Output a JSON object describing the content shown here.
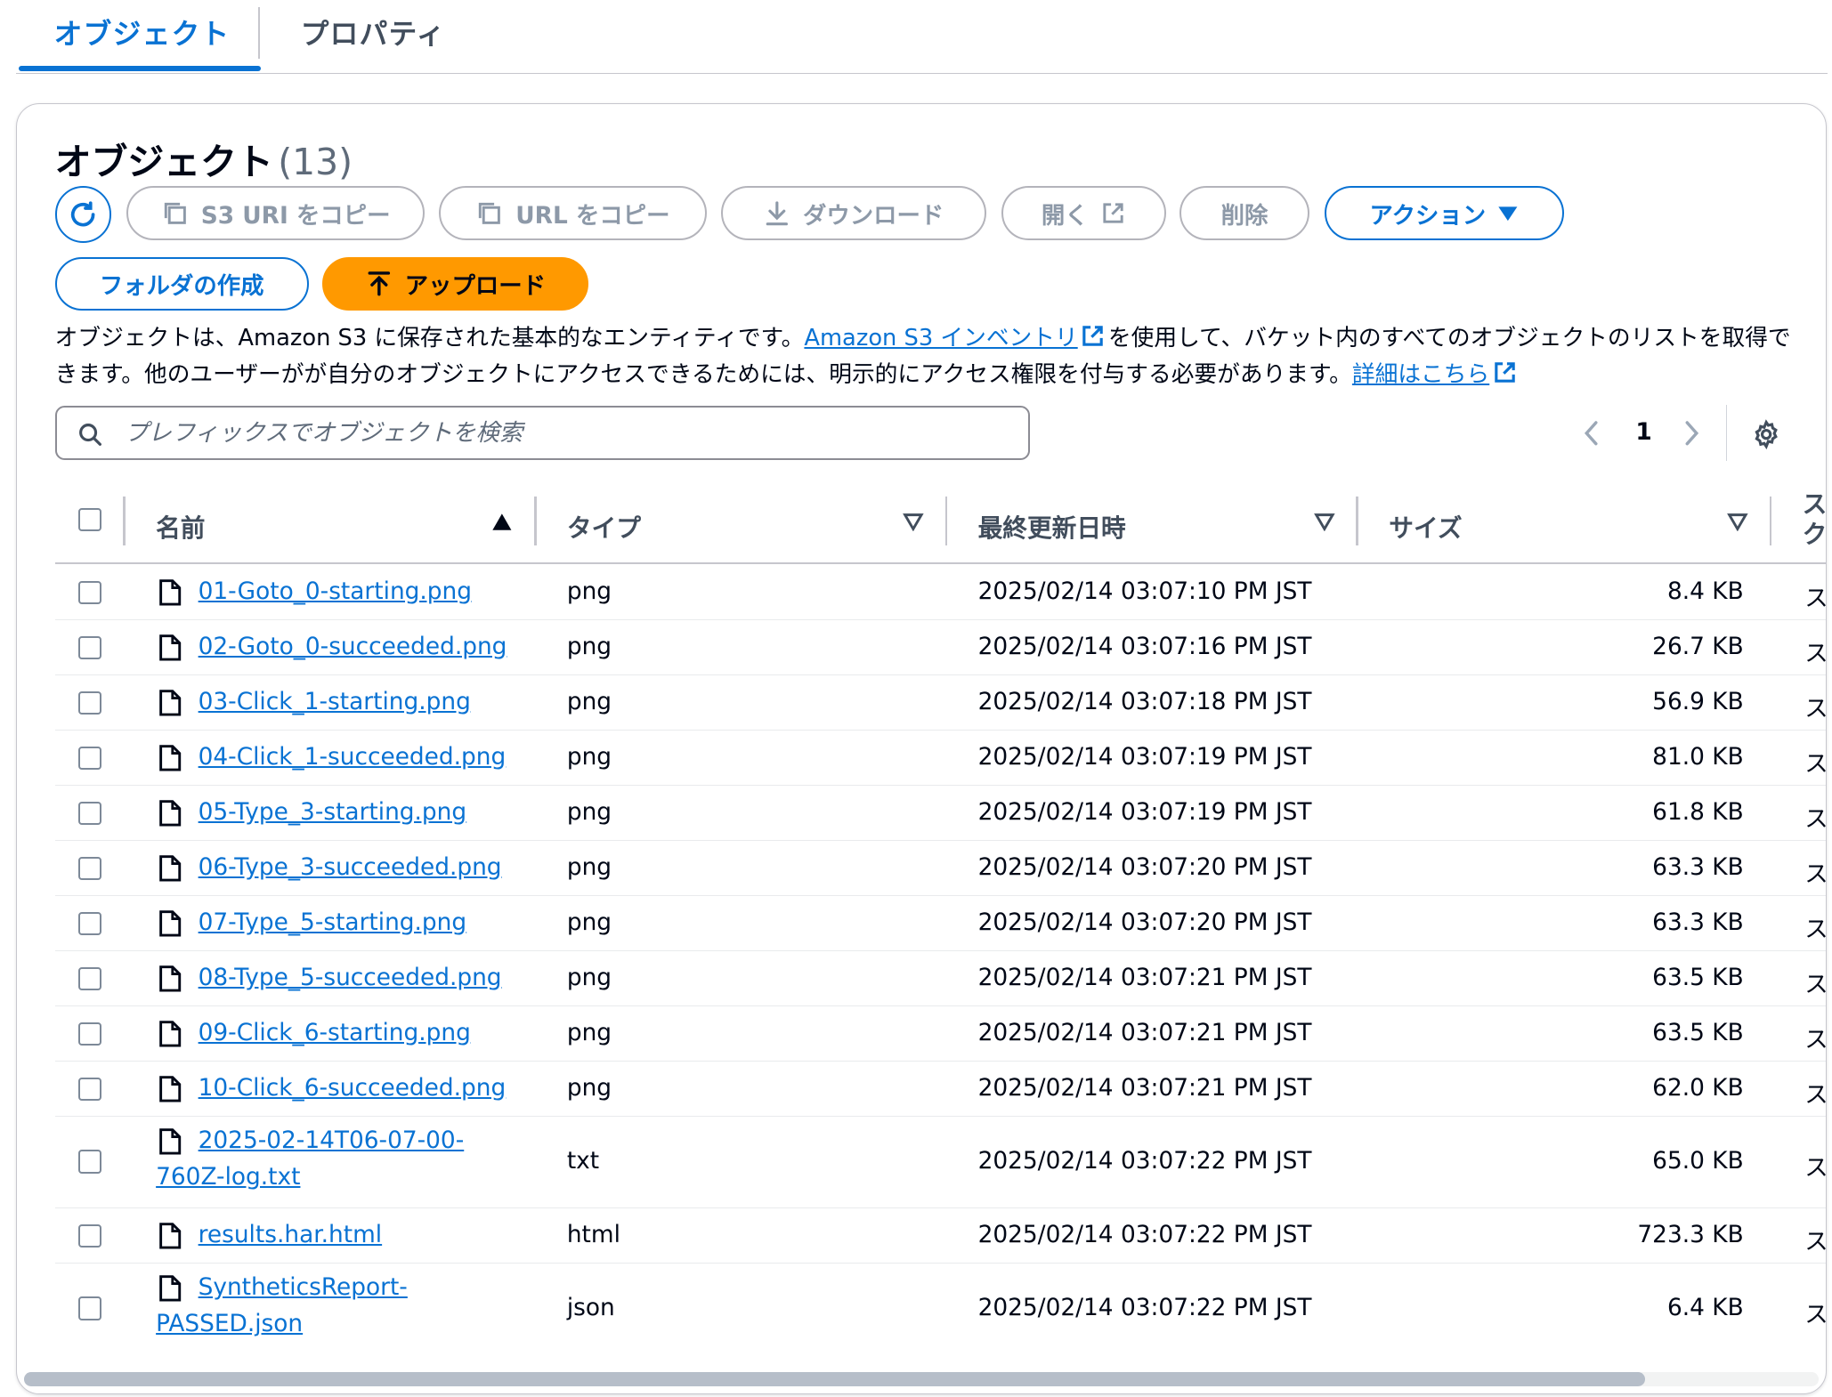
{
  "tabs": [
    {
      "label": "オブジェクト",
      "active": true
    },
    {
      "label": "プロパティ",
      "active": false
    }
  ],
  "header": {
    "title": "オブジェクト",
    "count": "(13)"
  },
  "toolbar": {
    "copy_s3_uri": "S3 URI をコピー",
    "copy_url": "URL をコピー",
    "download": "ダウンロード",
    "open": "開く",
    "delete": "削除",
    "actions": "アクション",
    "create_folder": "フォルダの作成",
    "upload": "アップロード"
  },
  "description": {
    "part1": "オブジェクトは、Amazon S3 に保存された基本的なエンティティです。",
    "link1": "Amazon S3 インベントリ",
    "part2": "を使用して、バケット内のすべてのオブジェクトのリストを取得できます。他のユーザーがが自分のオブジェクトにアクセスできるためには、明示的にアクセス権限を付与する必要があります。",
    "link2": "詳細はこちら"
  },
  "search": {
    "placeholder": "プレフィックスでオブジェクトを検索"
  },
  "pagination": {
    "prev": "‹",
    "page": "1",
    "next": "›"
  },
  "table": {
    "columns": {
      "name": "名前",
      "type": "タイプ",
      "modified": "最終更新日時",
      "size": "サイズ",
      "storage": "ス ク"
    },
    "rows": [
      {
        "name": "01-Goto_0-starting.png",
        "type": "png",
        "modified": "2025/02/14 03:07:10 PM JST",
        "size": "8.4 KB",
        "storage": "ス"
      },
      {
        "name": "02-Goto_0-succeeded.png",
        "type": "png",
        "modified": "2025/02/14 03:07:16 PM JST",
        "size": "26.7 KB",
        "storage": "ス"
      },
      {
        "name": "03-Click_1-starting.png",
        "type": "png",
        "modified": "2025/02/14 03:07:18 PM JST",
        "size": "56.9 KB",
        "storage": "ス"
      },
      {
        "name": "04-Click_1-succeeded.png",
        "type": "png",
        "modified": "2025/02/14 03:07:19 PM JST",
        "size": "81.0 KB",
        "storage": "ス"
      },
      {
        "name": "05-Type_3-starting.png",
        "type": "png",
        "modified": "2025/02/14 03:07:19 PM JST",
        "size": "61.8 KB",
        "storage": "ス"
      },
      {
        "name": "06-Type_3-succeeded.png",
        "type": "png",
        "modified": "2025/02/14 03:07:20 PM JST",
        "size": "63.3 KB",
        "storage": "ス"
      },
      {
        "name": "07-Type_5-starting.png",
        "type": "png",
        "modified": "2025/02/14 03:07:20 PM JST",
        "size": "63.3 KB",
        "storage": "ス"
      },
      {
        "name": "08-Type_5-succeeded.png",
        "type": "png",
        "modified": "2025/02/14 03:07:21 PM JST",
        "size": "63.5 KB",
        "storage": "ス"
      },
      {
        "name": "09-Click_6-starting.png",
        "type": "png",
        "modified": "2025/02/14 03:07:21 PM JST",
        "size": "63.5 KB",
        "storage": "ス"
      },
      {
        "name": "10-Click_6-succeeded.png",
        "type": "png",
        "modified": "2025/02/14 03:07:21 PM JST",
        "size": "62.0 KB",
        "storage": "ス"
      },
      {
        "name_line1": "2025-02-14T06-07-00-",
        "name_line2": "760Z-log.txt",
        "type": "txt",
        "modified": "2025/02/14 03:07:22 PM JST",
        "size": "65.0 KB",
        "storage": "ス"
      },
      {
        "name": "results.har.html",
        "type": "html",
        "modified": "2025/02/14 03:07:22 PM JST",
        "size": "723.3 KB",
        "storage": "ス"
      },
      {
        "name_line1": "SyntheticsReport-",
        "name_line2": "PASSED.json",
        "type": "json",
        "modified": "2025/02/14 03:07:22 PM JST",
        "size": "6.4 KB",
        "storage": "ス"
      }
    ]
  },
  "colors": {
    "accent": "#0972d3",
    "upload_button": "#ff9900",
    "disabled_text": "#8d99a8"
  }
}
